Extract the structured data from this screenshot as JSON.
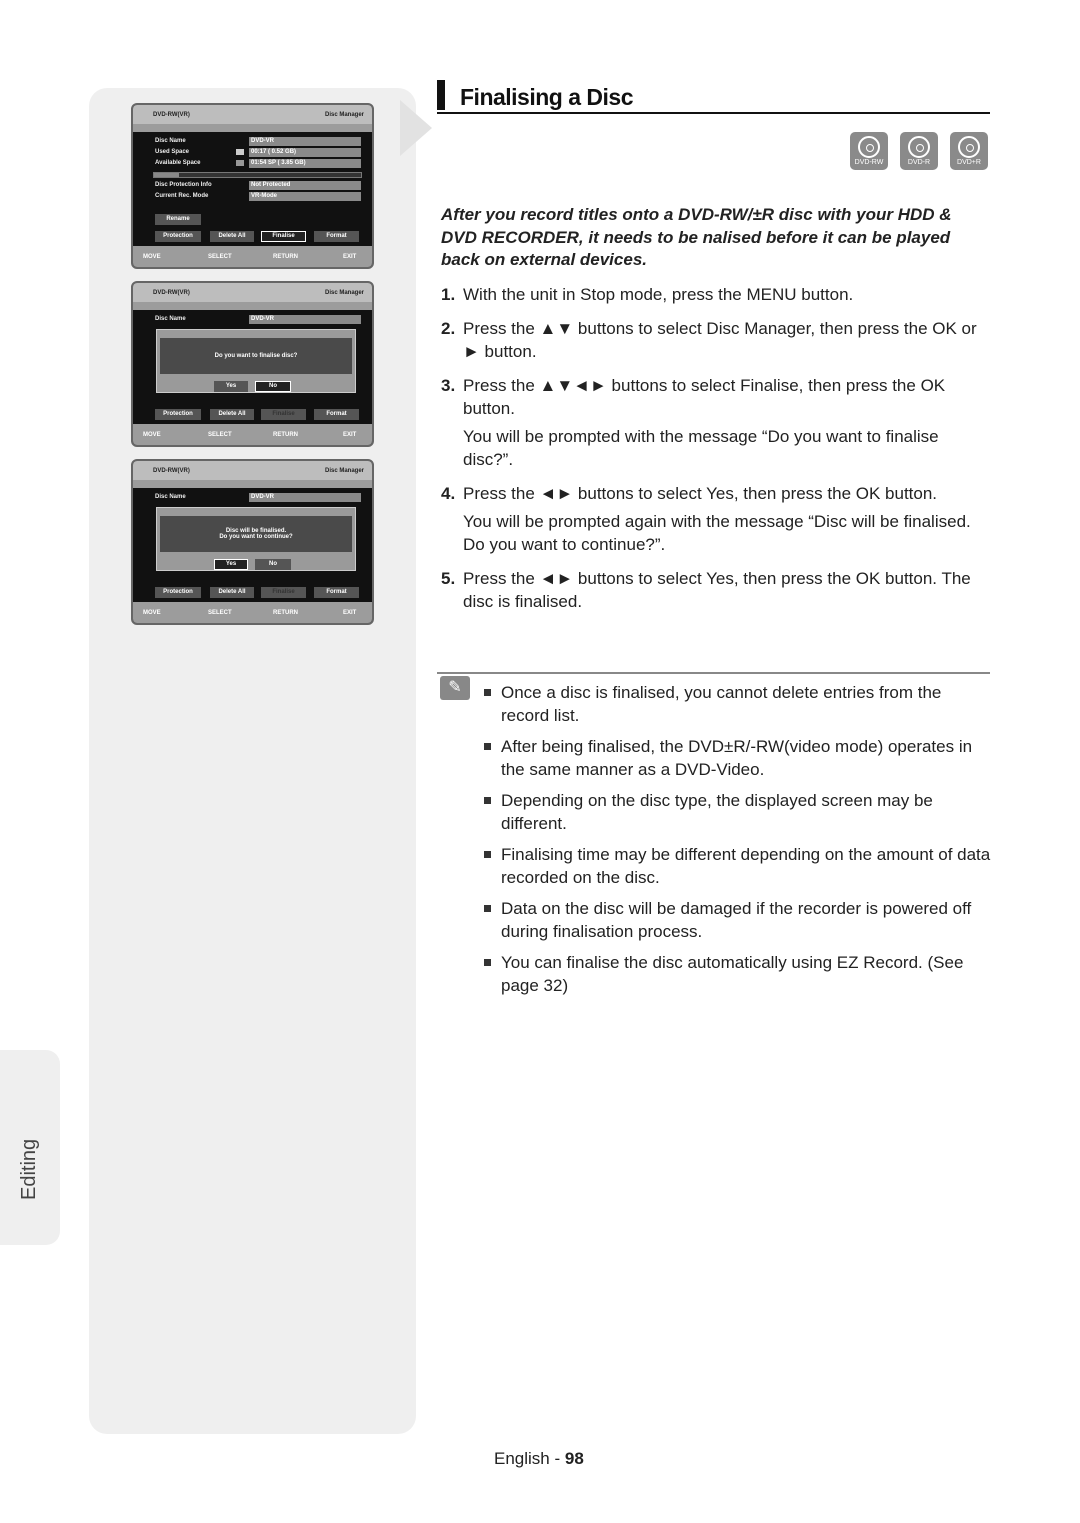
{
  "side_tab": "Editing",
  "screens": {
    "header_left": "DVD-RW(VR)",
    "header_right": "Disc Manager",
    "disc_name_label": "Disc Name",
    "disc_name": "DVD-VR",
    "used_label": "Used Space",
    "used_value": "00:17       ( 0.52 GB)",
    "avail_label": "Available Space",
    "avail_value": "01:54 SP   ( 3.85 GB)",
    "used_fraction": 0.12,
    "protect_label": "Disc Protection Info",
    "protect_value": "Not Protected",
    "mode_label": "Current Rec. Mode",
    "mode_value": "VR-Mode",
    "rename": "Rename",
    "protection": "Protection",
    "delete_all": "Delete All",
    "finalise": "Finalise",
    "format": "Format",
    "move": "MOVE",
    "select": "SELECT",
    "return": "RETURN",
    "exit": "EXIT",
    "dialog1": "Do you want to finalise disc?",
    "dialog2_line1": "Disc will be finalised.",
    "dialog2_line2": "Do you want to continue?",
    "yes": "Yes",
    "no": "No"
  },
  "title": "Finalising a Disc",
  "disc_types": [
    "DVD-RW",
    "DVD-R",
    "DVD+R"
  ],
  "intro": "After you record titles onto a DVD-RW/±R disc with your HDD & DVD RECORDER, it needs to be   nalised before it can be played back on external devices.",
  "steps": [
    {
      "n": "1.",
      "text": "With the unit in Stop mode, press the MENU button."
    },
    {
      "n": "2.",
      "text": "Press the ▲▼ buttons to select Disc Manager, then press the OK or ► button."
    },
    {
      "n": "3.",
      "text": "Press the ▲▼◄► buttons to select Finalise, then press the OK button.",
      "sub": "You will be prompted with the message “Do you want to finalise disc?”."
    },
    {
      "n": "4.",
      "text": "Press the ◄► buttons to select Yes, then press the OK button.",
      "sub": "You will be prompted again with the message “Disc will be finalised. Do you want to continue?”."
    },
    {
      "n": "5.",
      "text": "Press the ◄► buttons to select Yes, then press the OK button. The disc is finalised."
    }
  ],
  "notes": [
    "Once a disc is finalised, you cannot delete entries from the record list.",
    "After being finalised, the DVD±R/-RW(video mode) operates in the same manner as a DVD-Video.",
    "Depending on the disc type, the displayed screen may be different.",
    "Finalising time may be different depending on the amount of data recorded on the disc.",
    "Data on the disc will be damaged if the recorder is powered off during finalisation process.",
    "You can finalise the disc automatically using EZ Record. (See page 32)"
  ],
  "footer": {
    "lang": "English - ",
    "page": "98"
  }
}
